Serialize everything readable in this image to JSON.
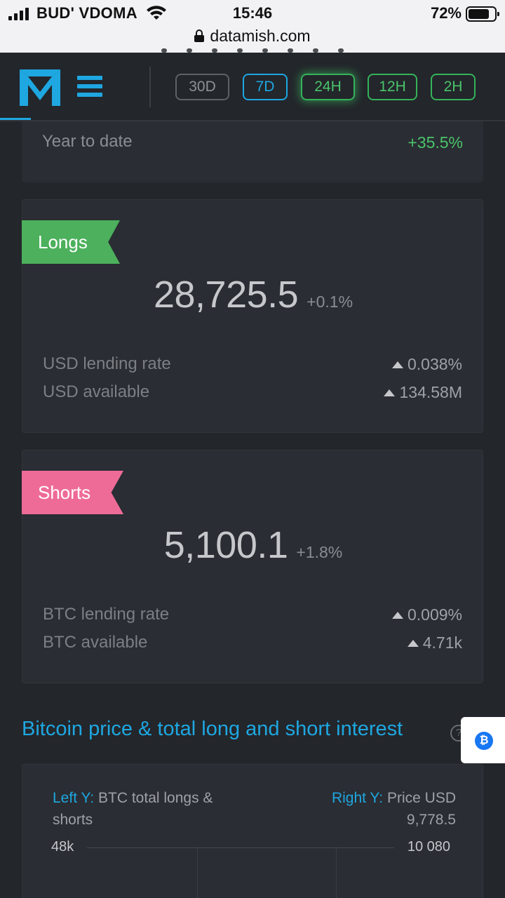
{
  "status_bar": {
    "carrier": "BUD' VDOMA",
    "time": "15:46",
    "battery_percent": "72%",
    "battery_level": 0.72,
    "url": "datamish.com"
  },
  "header": {
    "logo_icon": "datamish-logo",
    "menu_icon": "hamburger-menu-icon",
    "periods": [
      "30D",
      "7D",
      "24H",
      "12H",
      "2H"
    ],
    "selected_period": "24H",
    "colors": {
      "accent": "#1ea7e1",
      "green": "#4ac46b",
      "pink": "#ee6b98"
    }
  },
  "ytd": {
    "label": "Year to date",
    "value": "+35.5%"
  },
  "longs": {
    "tag": "Longs",
    "value": "28,725.5",
    "change": "+0.1%",
    "rows": [
      {
        "label": "USD lending rate",
        "value": "0.038%"
      },
      {
        "label": "USD available",
        "value": "134.58M"
      }
    ]
  },
  "shorts": {
    "tag": "Shorts",
    "value": "5,100.1",
    "change": "+1.8%",
    "rows": [
      {
        "label": "BTC lending rate",
        "value": "0.009%"
      },
      {
        "label": "BTC available",
        "value": "4.71k"
      }
    ]
  },
  "chart": {
    "title": "Bitcoin price & total long and short interest",
    "left_caption_key": "Left Y:",
    "left_caption_text": "BTC total longs & shorts",
    "right_caption_key": "Right Y:",
    "right_caption_text": "Price USD",
    "right_caption_value": "9,778.5",
    "left_tick": "48k",
    "right_tick": "10 080",
    "help_icon": "?",
    "widget_icon": "bitcoin-icon",
    "widget_glyph": "₿"
  }
}
